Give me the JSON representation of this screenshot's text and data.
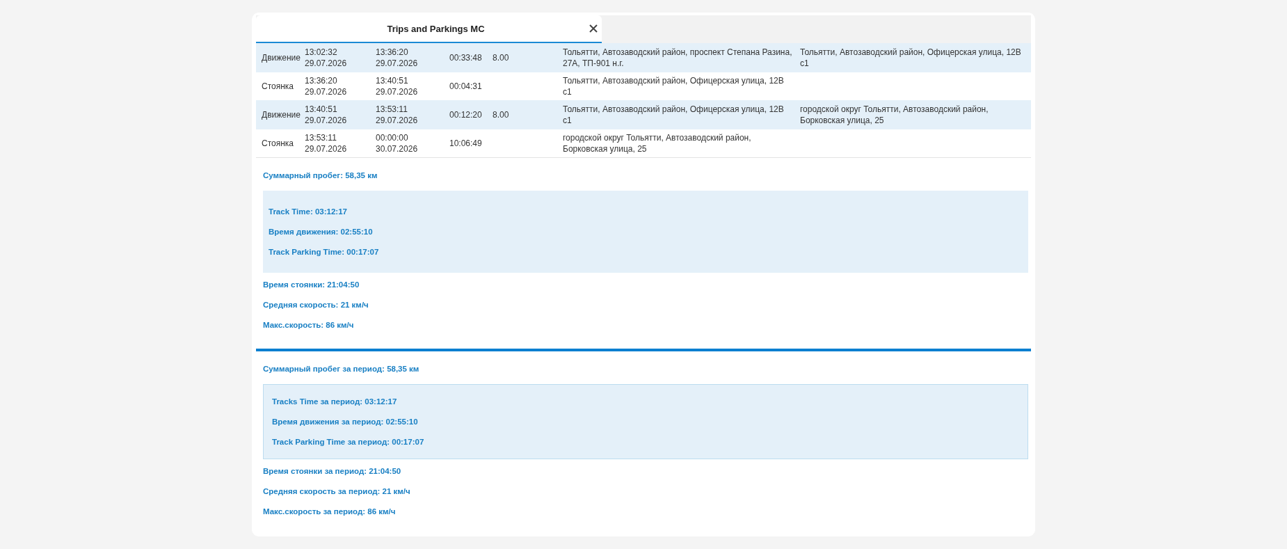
{
  "window": {
    "title": "Trips and Parkings MC"
  },
  "rows": [
    {
      "kind": "movement",
      "type": "Движение",
      "start": "13:02:32 29.07.2026",
      "end": "13:36:20 29.07.2026",
      "duration": "00:33:48",
      "mileage": "8.00",
      "start_address": "Тольятти, Автозаводский район, проспект Степана Разина, 27А, ТП-901 н.г.",
      "end_address": "Тольятти, Автозаводский район, Офицерская улица, 12В с1"
    },
    {
      "kind": "parking",
      "type": "Стоянка",
      "start": "13:36:20 29.07.2026",
      "end": "13:40:51 29.07.2026",
      "duration": "00:04:31",
      "start_address": "Тольятти, Автозаводский район, Офицерская улица, 12В с1"
    },
    {
      "kind": "movement",
      "type": "Движение",
      "start": "13:40:51 29.07.2026",
      "end": "13:53:11 29.07.2026",
      "duration": "00:12:20",
      "mileage": "8.00",
      "start_address": "Тольятти, Автозаводский район, Офицерская улица, 12В с1",
      "end_address": "городской округ Тольятти, Автозаводский район, Борковская улица, 25"
    },
    {
      "kind": "parking",
      "type": "Стоянка",
      "start": "13:53:11 29.07.2026",
      "end": "00:00:00 30.07.2026",
      "duration": "10:06:49",
      "start_address": "городской округ Тольятти, Автозаводский район, Борковская улица, 25"
    }
  ],
  "summary": {
    "total": "Суммарный пробег: 58,35 км",
    "box": [
      "Track Time: 03:12:17",
      "Время движения: 02:55:10",
      "Track Parking Time: 00:17:07"
    ],
    "lines": [
      "Время стоянки: 21:04:50",
      "Средняя скорость: 21 км/ч",
      "Макс.скорость: 86 км/ч"
    ]
  },
  "period_summary": {
    "total": "Суммарный пробег за период: 58,35 км",
    "box": [
      "Tracks Time за период: 03:12:17",
      "Время движения за период: 02:55:10",
      "Track Parking Time за период: 00:17:07"
    ],
    "lines": [
      "Время стоянки за период: 21:04:50",
      "Средняя скорость за период: 21 км/ч",
      "Макс.скорость за период: 86 км/ч"
    ]
  }
}
